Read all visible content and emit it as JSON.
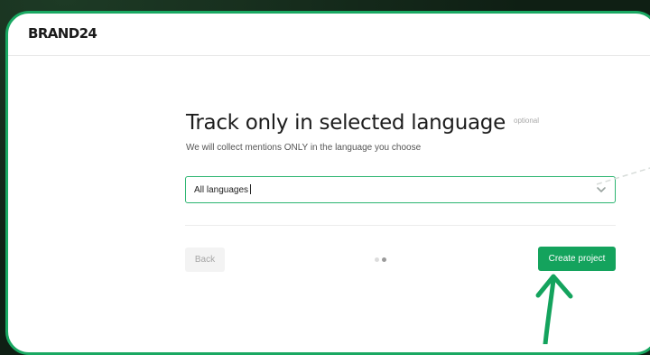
{
  "brand": {
    "logo_text": "BRAND24"
  },
  "step": {
    "title": "Track only in selected language",
    "optional_tag": "optional",
    "subtitle": "We will collect mentions ONLY in the language you choose"
  },
  "language_select": {
    "value": "All languages",
    "chevron_icon": "chevron-down-icon"
  },
  "navigation": {
    "back_label": "Back",
    "create_label": "Create project",
    "steps_total": 2,
    "current_step": 2
  },
  "colors": {
    "accent": "#14a35d",
    "frame_border": "#19a862",
    "background": "#0f1f14"
  },
  "annotations": {
    "arrow_icon": "arrow-up-icon",
    "connector": "dashed-line"
  }
}
